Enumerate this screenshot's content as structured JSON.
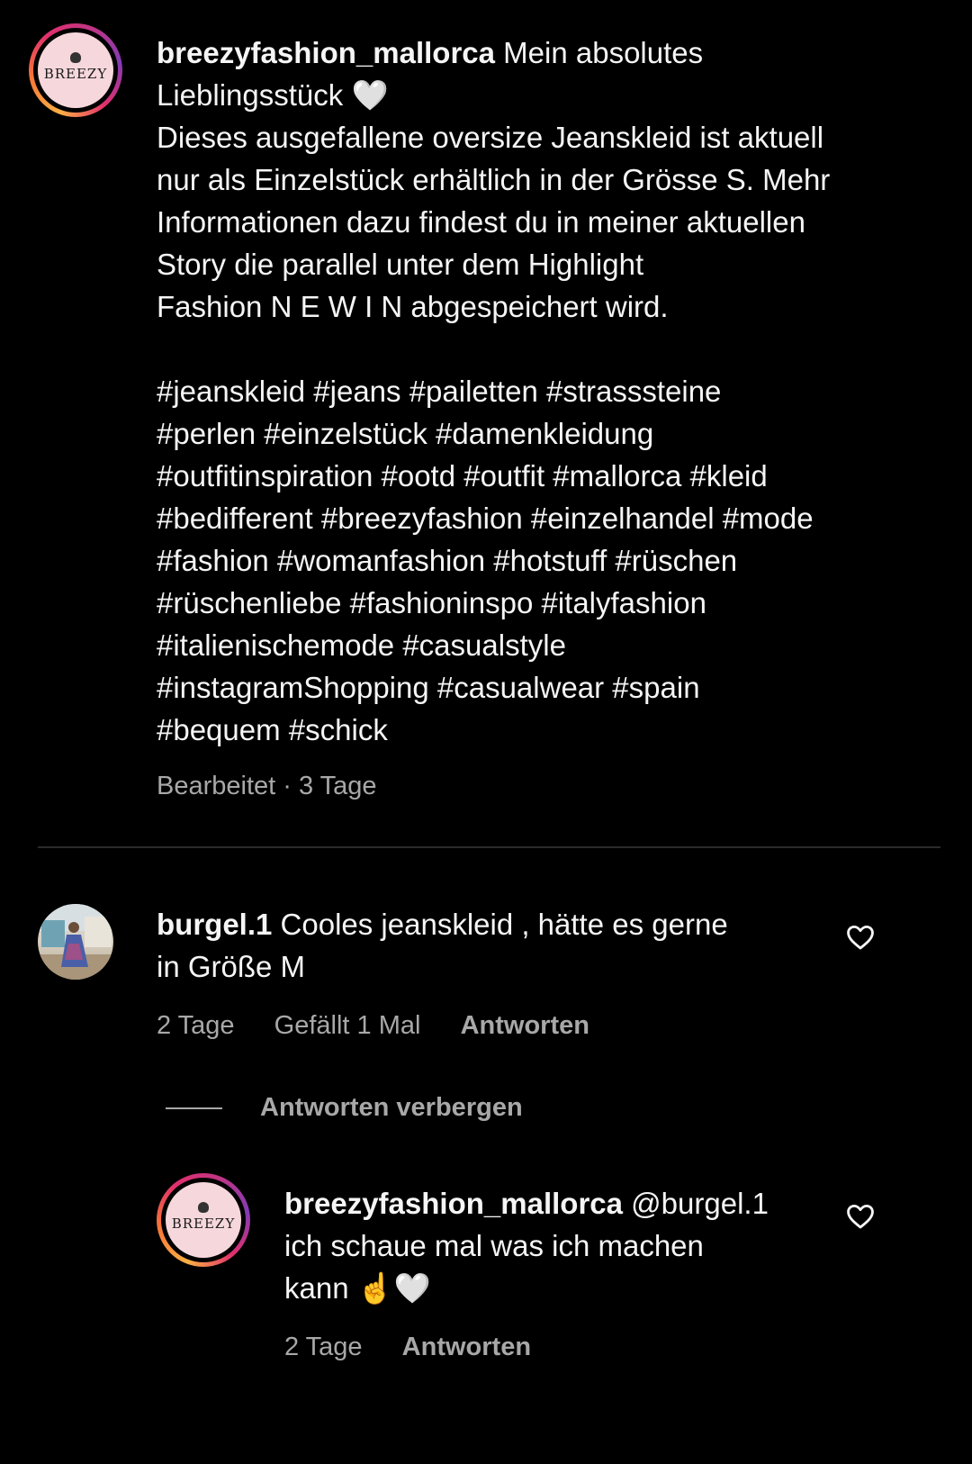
{
  "caption": {
    "username": "breezyfashion_mallorca",
    "text_lines": [
      "Mein absolutes",
      "Lieblingsstück 🤍",
      "Dieses ausgefallene oversize Jeanskleid ist aktuell",
      "nur als Einzelstück erhältlich in der Grösse S. Mehr",
      "Informationen dazu findest du in meiner aktuellen",
      "Story die parallel unter dem Highlight",
      "Fashion N E W I N abgespeichert wird."
    ],
    "hashtag_lines": [
      "#jeanskleid #jeans #pailetten #strasssteine",
      "#perlen #einzelstück #damenkleidung",
      "#outfitinspiration #ootd #outfit #mallorca #kleid",
      "#bedifferent #breezyfashion #einzelhandel #mode",
      "#fashion #womanfashion #hotstuff #rüschen",
      "#rüschenliebe #fashioninspo #italyfashion",
      "#italienischemode #casualstyle",
      "#instagramShopping #casualwear #spain",
      "#bequem #schick"
    ],
    "meta": "Bearbeitet · 3 Tage",
    "avatar_logo": "BREEZY"
  },
  "comment": {
    "username": "burgel.1",
    "text_lines": [
      "Cooles jeanskleid , hätte es gerne",
      "in Größe M"
    ],
    "time": "2 Tage",
    "likes": "Gefällt 1 Mal",
    "reply_label": "Antworten",
    "hide_replies": "Antworten verbergen"
  },
  "reply": {
    "username": "breezyfashion_mallorca",
    "mention": "@burgel.1",
    "text_lines": [
      "ich schaue mal was ich machen",
      "kann ☝️🤍"
    ],
    "time": "2 Tage",
    "reply_label": "Antworten",
    "avatar_logo": "BREEZY"
  },
  "icons": {
    "like": "heart-outline-icon"
  }
}
